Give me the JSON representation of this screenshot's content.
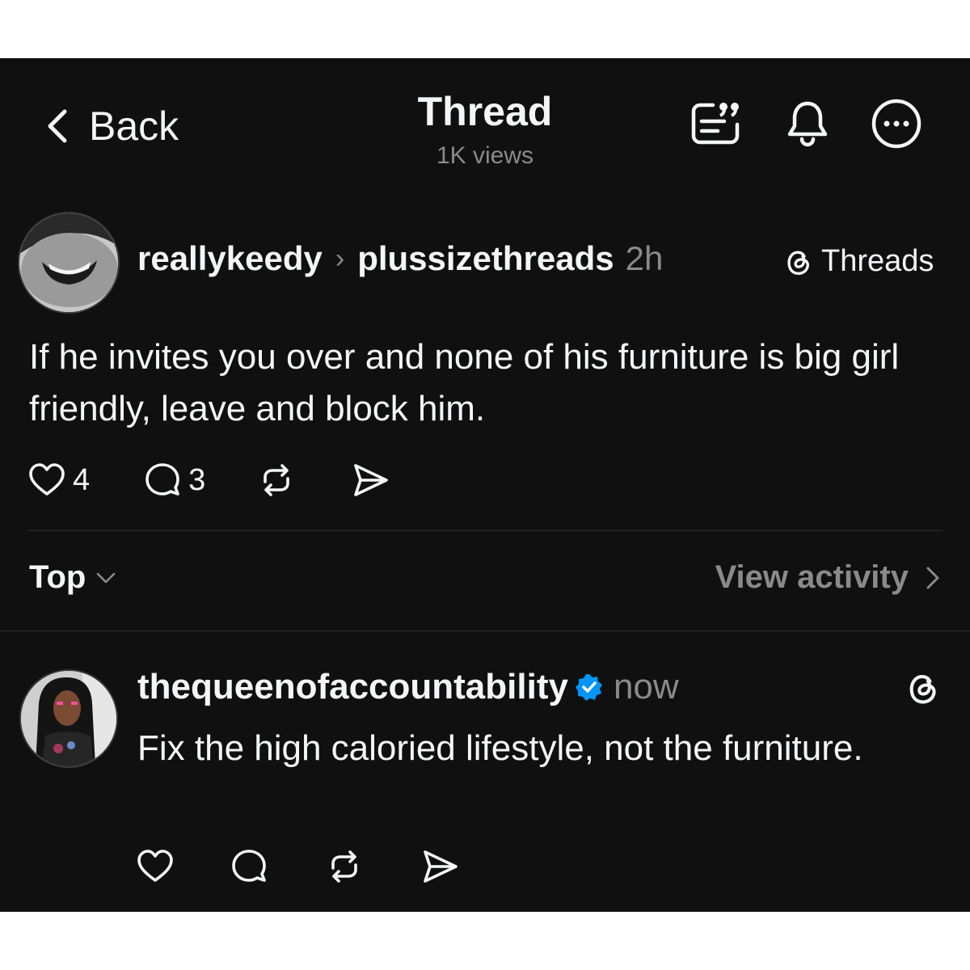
{
  "header": {
    "back_label": "Back",
    "title": "Thread",
    "views": "1K views",
    "icons": [
      "quote-post-icon",
      "bell-icon",
      "more-icon"
    ]
  },
  "post": {
    "author": "reallykeedy",
    "community": "plussizethreads",
    "time": "2h",
    "source_label": "Threads",
    "text": "If he invites you over and none of his furniture is big girl friendly, leave and block him.",
    "likes": "4",
    "replies": "3"
  },
  "sort": {
    "label": "Top",
    "view_activity": "View activity"
  },
  "reply": {
    "author": "thequeenofaccountability",
    "verified": true,
    "time": "now",
    "text": "Fix the high caloried lifestyle, not the furniture."
  },
  "colors": {
    "background": "#101010",
    "text": "#f3f5f7",
    "muted": "#8a8a8a",
    "verified": "#0095f6"
  }
}
